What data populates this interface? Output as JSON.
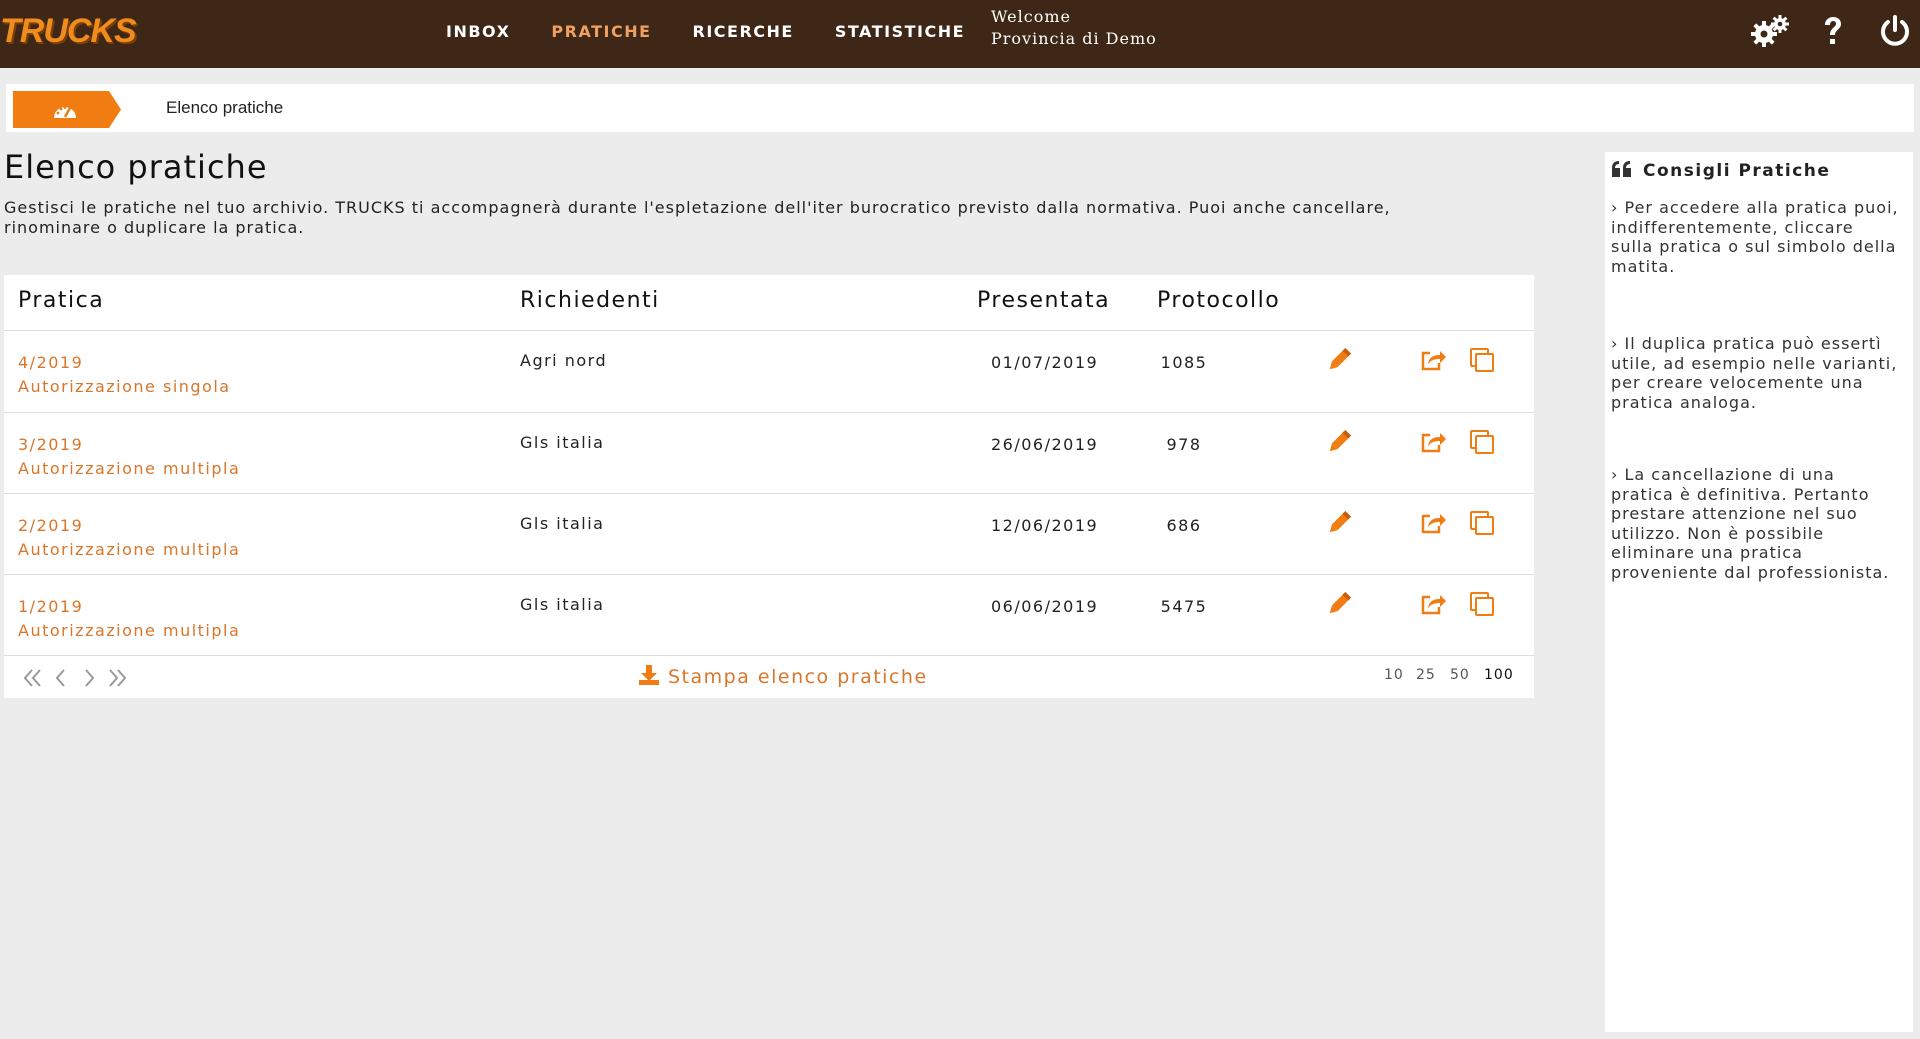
{
  "app": {
    "logo": "TRUCKS"
  },
  "nav": [
    {
      "label": "INBOX",
      "active": false
    },
    {
      "label": "PRATICHE",
      "active": true
    },
    {
      "label": "RICERCHE",
      "active": false
    },
    {
      "label": "STATISTICHE",
      "active": false
    }
  ],
  "user": {
    "welcome": "Welcome",
    "org": "Provincia di Demo"
  },
  "header_icons": [
    "settings-icon",
    "help-icon",
    "power-icon"
  ],
  "breadcrumb": {
    "home_icon": "dashboard-icon",
    "current": "Elenco pratiche"
  },
  "page": {
    "title": "Elenco pratiche",
    "description": "Gestisci le pratiche nel tuo archivio. TRUCKS ti accompagnerà durante l'espletazione dell'iter burocratico previsto dalla normativa. Puoi anche cancellare, rinominare o duplicare la pratica."
  },
  "table": {
    "headers": {
      "pratica": "Pratica",
      "richiedenti": "Richiedenti",
      "presentata": "Presentata",
      "protocollo": "Protocollo"
    },
    "rows": [
      {
        "number": "4/2019",
        "type": "Autorizzazione singola",
        "applicant": "Agri nord",
        "date": "01/07/2019",
        "protocol": "1085"
      },
      {
        "number": "3/2019",
        "type": "Autorizzazione multipla",
        "applicant": "Gls italia",
        "date": "26/06/2019",
        "protocol": "978"
      },
      {
        "number": "2/2019",
        "type": "Autorizzazione multipla",
        "applicant": "Gls italia",
        "date": "12/06/2019",
        "protocol": "686"
      },
      {
        "number": "1/2019",
        "type": "Autorizzazione multipla",
        "applicant": "Gls italia",
        "date": "06/06/2019",
        "protocol": "5475"
      }
    ],
    "row_actions": [
      "edit-pencil-icon",
      "share-icon",
      "duplicate-icon"
    ],
    "print_label": "Stampa elenco pratiche",
    "page_sizes": [
      "10",
      "25",
      "50",
      "100"
    ],
    "accent": "#d9762a"
  },
  "tips": {
    "title": "Consigli Pratiche",
    "items": [
      "› Per accedere alla pratica puoi, indifferentemente, cliccare sulla pratica o sul simbolo della matita.",
      "› Il duplica pratica può essertì utile, ad esempio nelle varianti, per creare velocemente una pratica analoga.",
      "› La cancellazione di una pratica è definitiva. Pertanto prestare attenzione nel suo utilizzo. Non è possibile eliminare una pratica proveniente dal professionista."
    ]
  },
  "colors": {
    "topbar": "#3e2716",
    "accent": "#f08c1e",
    "link": "#d9762a",
    "background": "#ececec"
  }
}
